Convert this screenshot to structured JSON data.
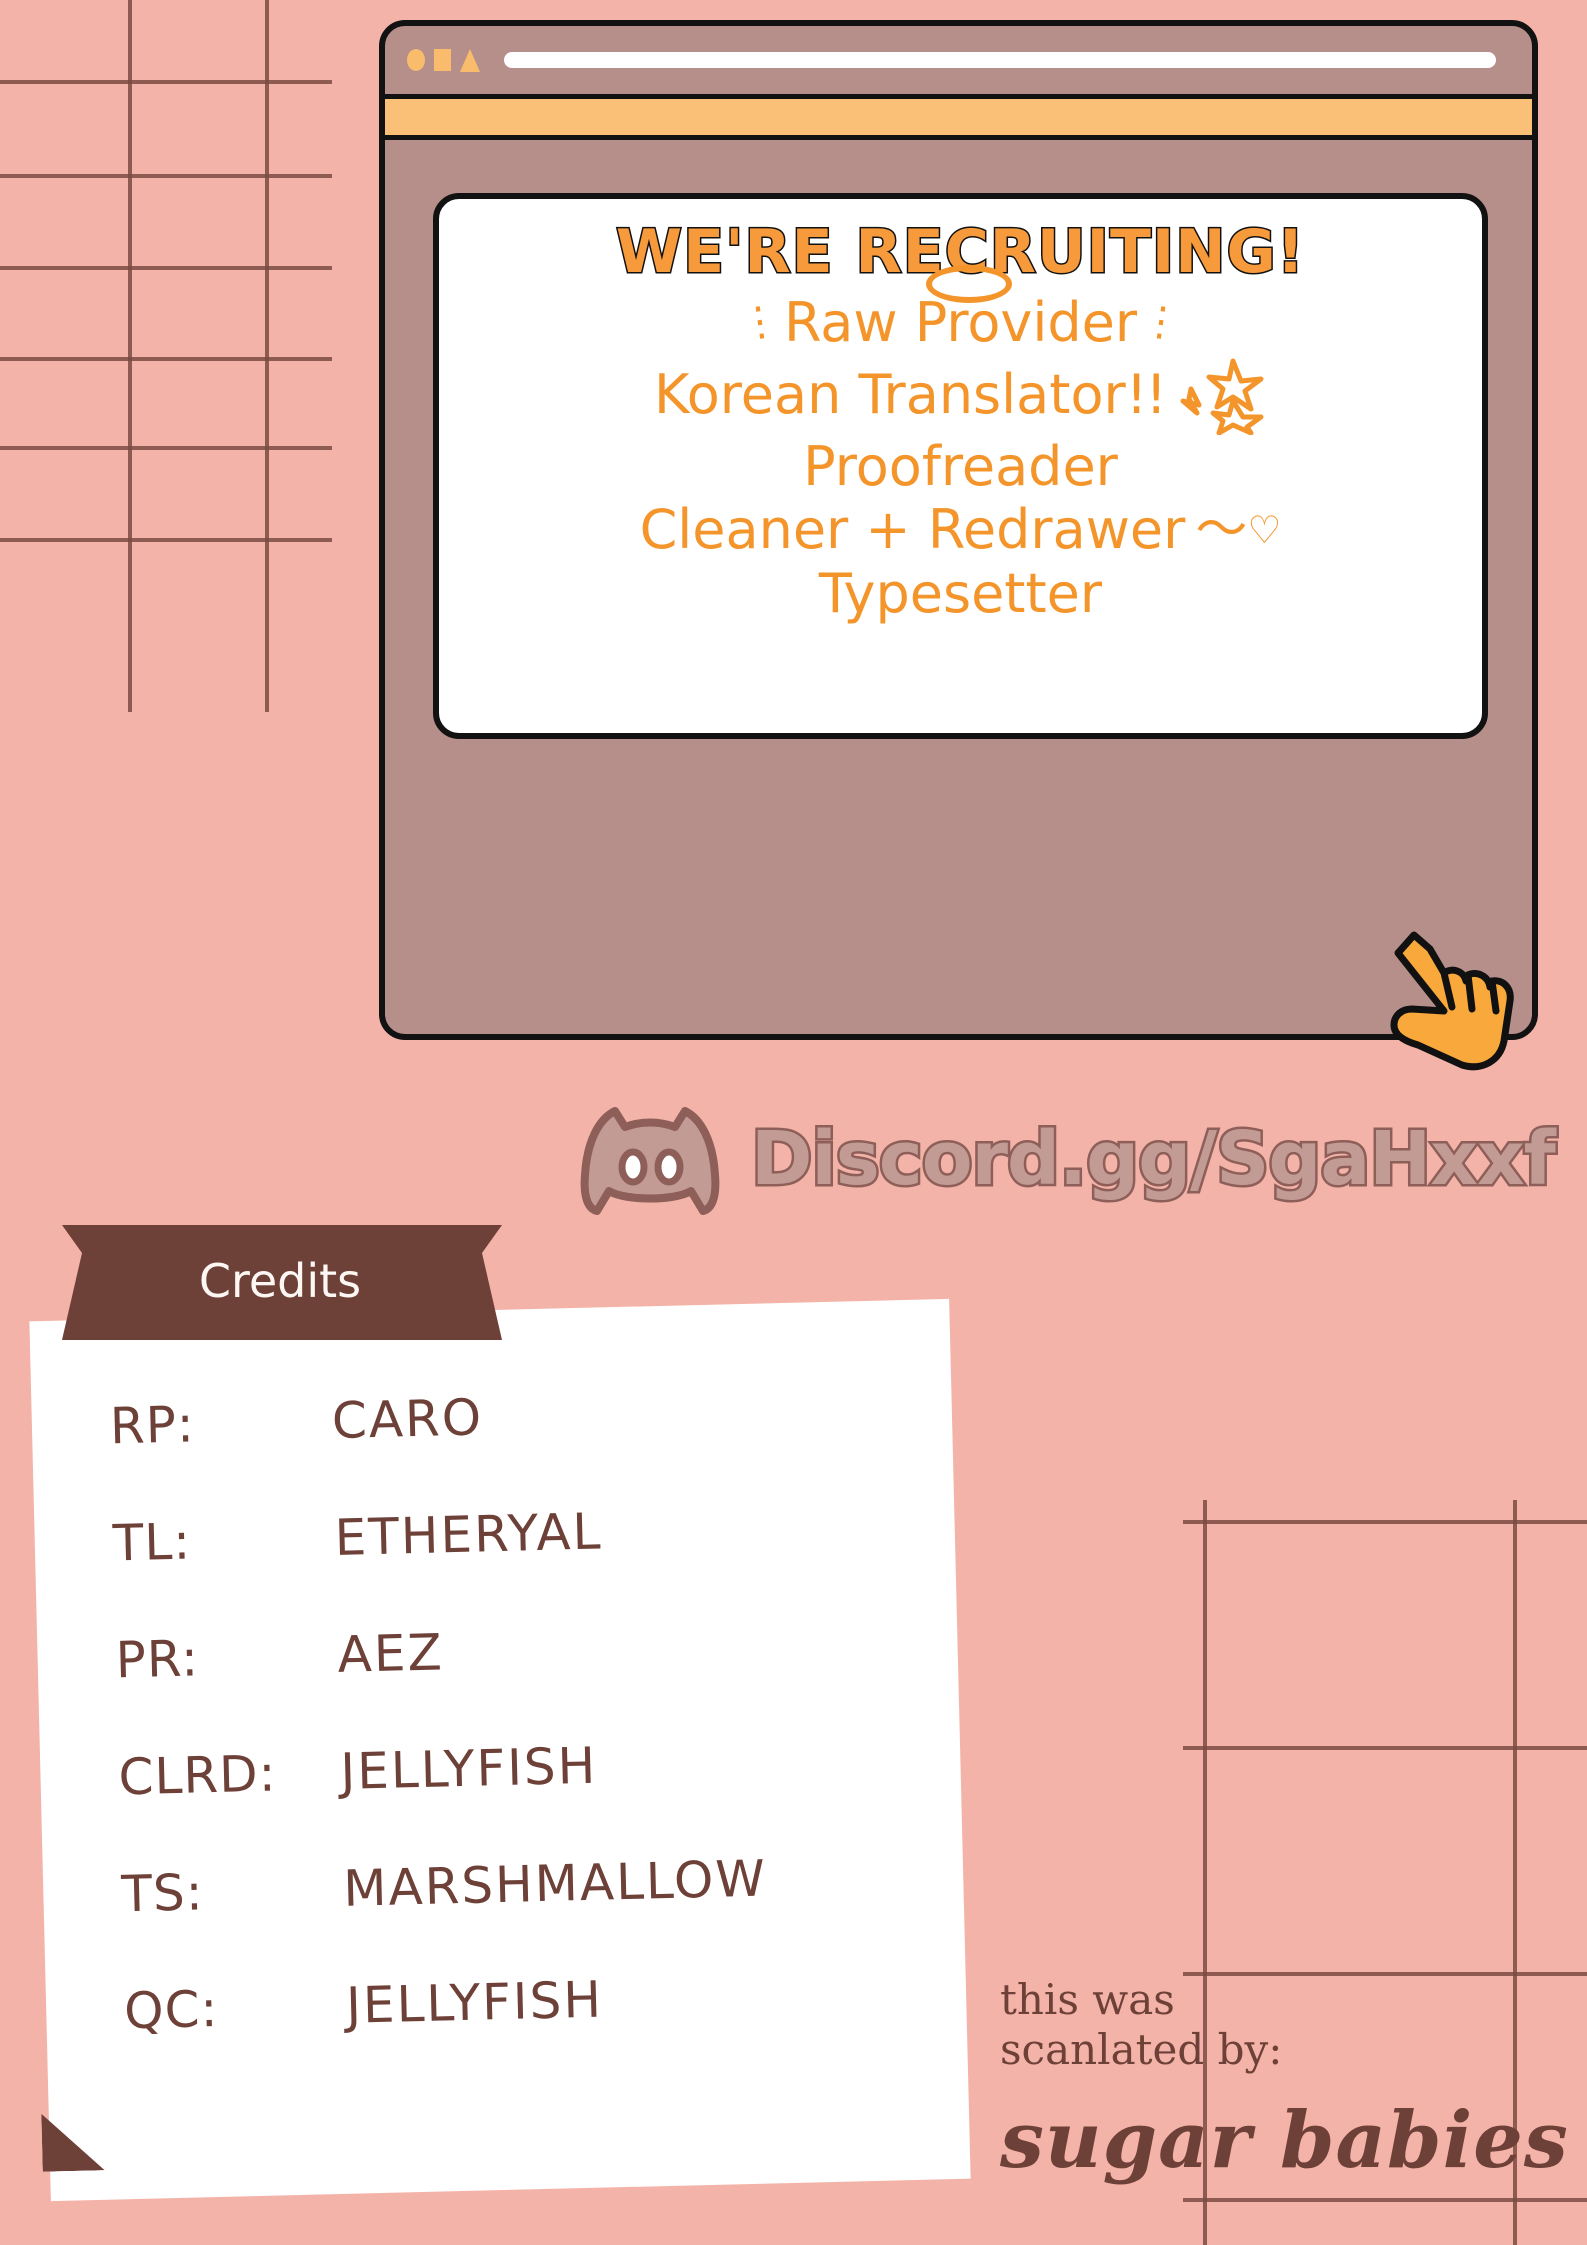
{
  "colors": {
    "background": "#f4b3a8",
    "grid_line": "#7a4b42",
    "browser_frame": "#b78f8a",
    "browser_toolbar": "#fbc078",
    "accent_orange": "#f4952b",
    "heading_orange": "#f79a3c",
    "dark_brown": "#6d4038",
    "discord_fill": "#c39b95",
    "discord_outline": "#8d5f58",
    "cursor_orange": "#f9a93c",
    "page_white": "#ffffff",
    "outline_black": "#121212"
  },
  "browser": {
    "window_controls": [
      "circle-dot",
      "square-dot",
      "triangle-dot"
    ],
    "address_bar_value": ""
  },
  "poster": {
    "heading": "WE'RE RECRUITING!",
    "roles": [
      {
        "label": "Raw Provider",
        "deco_left": "sparkle-left",
        "deco_right": "sparkle-right",
        "deco_top": "halo"
      },
      {
        "label": "Korean Translator",
        "suffix": "!!",
        "deco_right": "stars"
      },
      {
        "label": "Proofreader"
      },
      {
        "label": "Cleaner + Redrawer",
        "deco_right": "tilde-heart"
      },
      {
        "label": "Typesetter"
      }
    ]
  },
  "discord": {
    "icon": "discord-logo-icon",
    "link": "Discord.gg/SgaHxxf"
  },
  "credits": {
    "ribbon_title": "Credits",
    "rows": [
      {
        "role": "RP:",
        "name": "CARO"
      },
      {
        "role": "TL:",
        "name": "ETHERYAL"
      },
      {
        "role": "PR:",
        "name": "AEZ"
      },
      {
        "role": "CLRD:",
        "name": "JELLYFISH"
      },
      {
        "role": "TS:",
        "name": "MARSHMALLOW"
      },
      {
        "role": "QC:",
        "name": "JELLYFISH"
      }
    ]
  },
  "scanlation": {
    "line1": "this was",
    "line2": "scanlated by:",
    "group": "sugar babies"
  }
}
